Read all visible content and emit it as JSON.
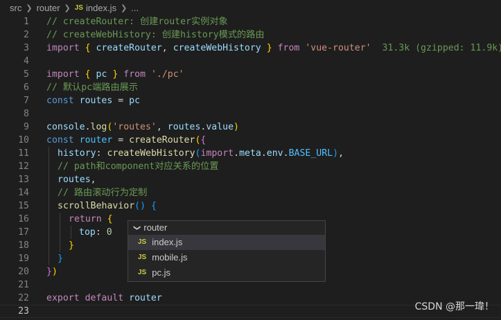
{
  "breadcrumb": {
    "items": [
      "src",
      "router",
      "index.js",
      "..."
    ],
    "js_badge": "JS"
  },
  "line_numbers": [
    "1",
    "2",
    "3",
    "4",
    "5",
    "6",
    "7",
    "8",
    "9",
    "10",
    "11",
    "12",
    "13",
    "14",
    "15",
    "16",
    "17",
    "18",
    "19",
    "20",
    "21",
    "22",
    "23"
  ],
  "code": {
    "l1": "// createRouter: 创建router实例对象",
    "l2": "// createWebHistory: 创建history模式的路由",
    "l3": {
      "import": "import",
      "ob": "{",
      "name1": "createRouter",
      "comma": ",",
      "name2": "createWebHistory",
      "cb": "}",
      "from": "from",
      "src": "'vue-router'",
      "hint": "31.3k (gzipped: 11.9k)"
    },
    "l5": {
      "import": "import",
      "ob": "{",
      "name": "pc",
      "cb": "}",
      "from": "from",
      "src": "'./pc'"
    },
    "l6": "// 默认pc端路由展示",
    "l7": {
      "const": "const",
      "name": "routes",
      "eq": "=",
      "val": "pc"
    },
    "l9": {
      "obj": "console",
      "dot": ".",
      "fn": "log",
      "op": "(",
      "str": "'routes'",
      "comma": ",",
      "arg": "routes",
      "dot2": ".",
      "prop": "value",
      "cp": ")"
    },
    "l10": {
      "const": "const",
      "name": "router",
      "eq": "=",
      "fn": "createRouter",
      "op": "(",
      "ob": "{"
    },
    "l11": {
      "key": "history",
      "colon": ":",
      "fn": "createWebHistory",
      "op": "(",
      "imp": "import",
      "d1": ".",
      "meta": "meta",
      "d2": ".",
      "env": "env",
      "d3": ".",
      "base": "BASE_URL",
      "cp": ")",
      "comma": ","
    },
    "l12": "// path和component对应关系的位置",
    "l13": {
      "name": "routes",
      "comma": ","
    },
    "l14": "// 路由滚动行为定制",
    "l15": {
      "fn": "scrollBehavior",
      "parens": "()",
      "ob": "{"
    },
    "l16": {
      "kw": "return",
      "ob": "{"
    },
    "l17": {
      "key": "top",
      "colon": ":",
      "val": "0"
    },
    "l18": "}",
    "l19": "}",
    "l20": {
      "cb": "}",
      "cp": ")"
    },
    "l22": {
      "export": "export",
      "default": "default",
      "name": "router"
    }
  },
  "popup": {
    "folder": "router",
    "files": [
      "index.js",
      "mobile.js",
      "pc.js"
    ],
    "selected": "index.js"
  },
  "watermark": "CSDN @那一瑋！"
}
